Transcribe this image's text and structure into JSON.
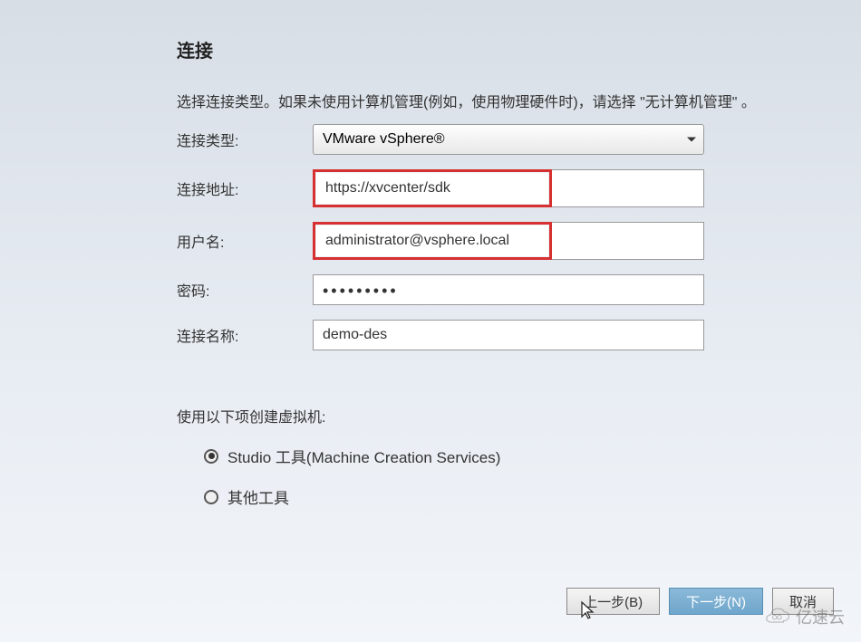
{
  "page": {
    "title": "连接",
    "instruction": "选择连接类型。如果未使用计算机管理(例如，使用物理硬件时)，请选择 \"无计算机管理\" 。"
  },
  "form": {
    "connection_type_label": "连接类型:",
    "connection_type_value": "VMware vSphere®",
    "connection_address_label": "连接地址:",
    "connection_address_value": "https://xvcenter/sdk",
    "username_label": "用户名:",
    "username_value": "administrator@vsphere.local",
    "password_label": "密码:",
    "password_value": "•••••••••",
    "connection_name_label": "连接名称:",
    "connection_name_value": "demo-des"
  },
  "vm_section": {
    "title": "使用以下项创建虚拟机:",
    "option_studio": "Studio 工具(Machine Creation Services)",
    "option_other": "其他工具"
  },
  "buttons": {
    "back": "上一步(B)",
    "next": "下一步(N)",
    "cancel": "取消"
  },
  "watermark": {
    "text": "亿速云"
  }
}
